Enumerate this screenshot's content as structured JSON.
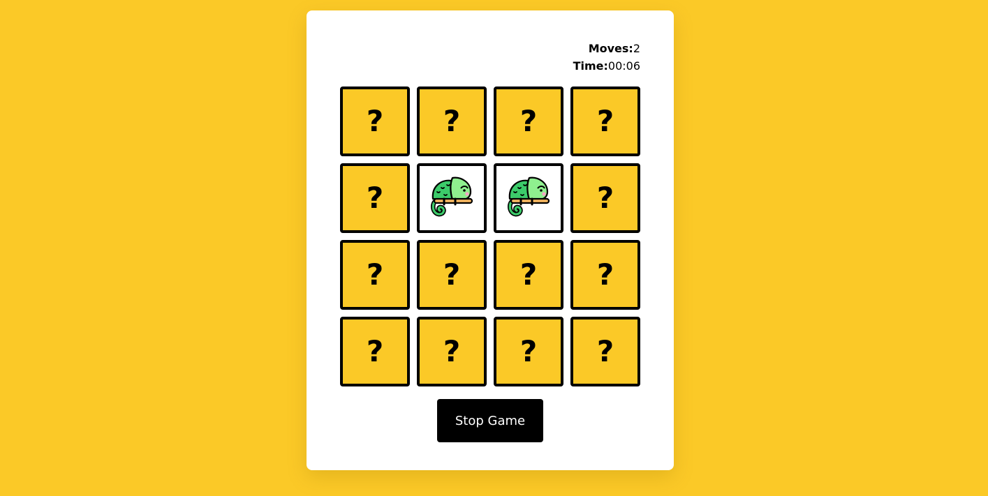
{
  "stats": {
    "moves_label": "Moves:",
    "moves_value": "2",
    "time_label": "Time:",
    "time_value": "00:06"
  },
  "board": {
    "hidden_symbol": "?",
    "cards": [
      {
        "state": "hidden"
      },
      {
        "state": "hidden"
      },
      {
        "state": "hidden"
      },
      {
        "state": "hidden"
      },
      {
        "state": "hidden"
      },
      {
        "state": "revealed",
        "image": "chameleon-icon"
      },
      {
        "state": "revealed",
        "image": "chameleon-icon"
      },
      {
        "state": "hidden"
      },
      {
        "state": "hidden"
      },
      {
        "state": "hidden"
      },
      {
        "state": "hidden"
      },
      {
        "state": "hidden"
      },
      {
        "state": "hidden"
      },
      {
        "state": "hidden"
      },
      {
        "state": "hidden"
      },
      {
        "state": "hidden"
      }
    ]
  },
  "controls": {
    "stop_label": "Stop Game"
  },
  "colors": {
    "background": "#fbc927",
    "card_back": "#fbc927",
    "card_face": "#ffffff",
    "border": "#000000",
    "button": "#000000",
    "chameleon": "#4cd87a"
  }
}
